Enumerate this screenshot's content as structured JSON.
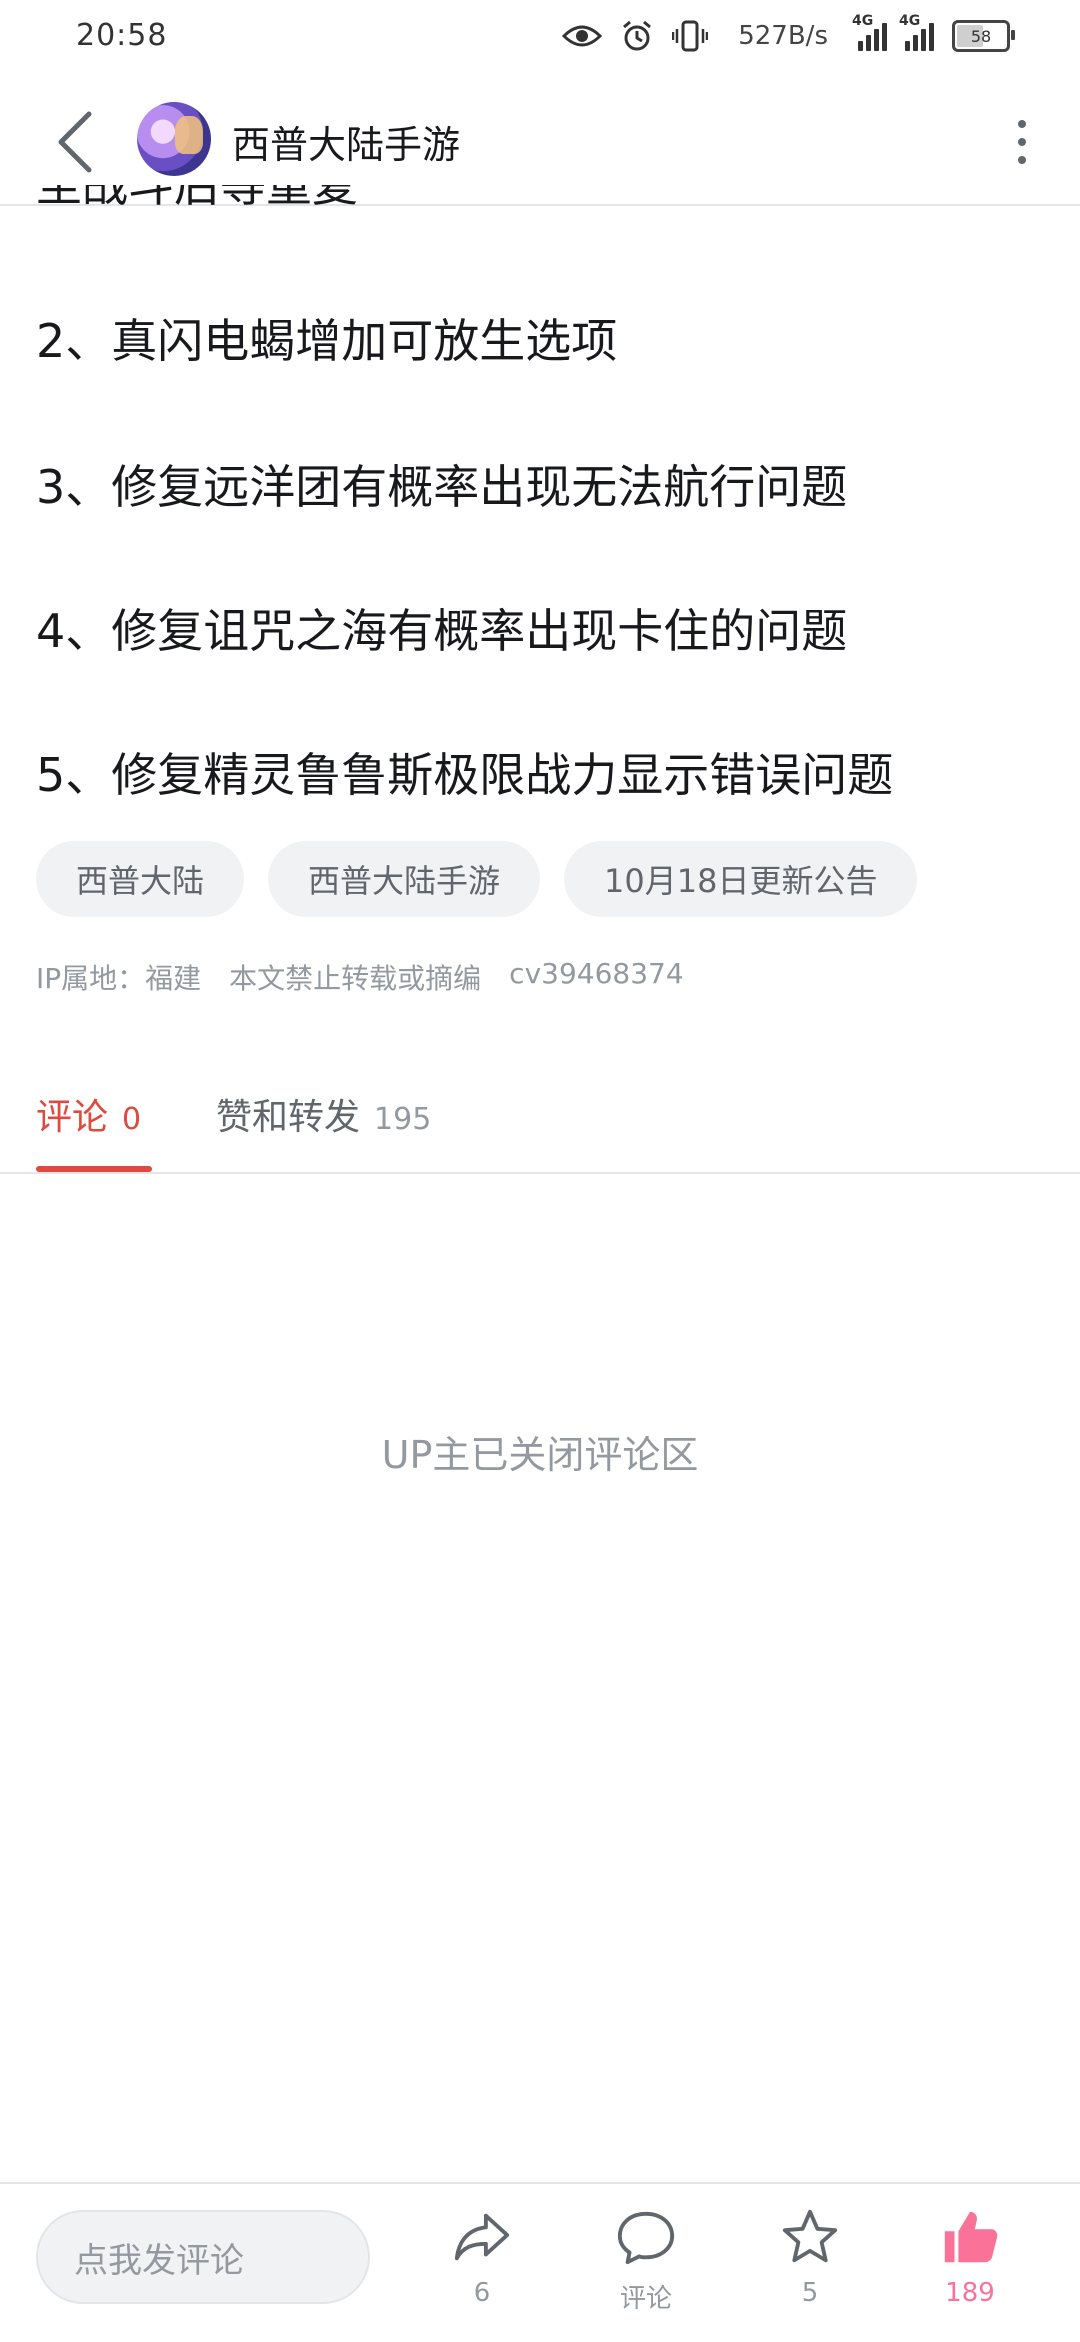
{
  "status_bar": {
    "time": "20:58",
    "speed": "527B/s",
    "network1": "4G",
    "network2": "4G",
    "battery": "58",
    "battery_level": 0.58
  },
  "header": {
    "title": "西普大陆手游"
  },
  "article": {
    "cut_line": "至战斗后等重复",
    "lines": [
      "2、真闪电蝎增加可放生选项",
      "3、修复远洋团有概率出现无法航行问题",
      "4、修复诅咒之海有概率出现卡住的问题",
      "5、修复精灵鲁鲁斯极限战力显示错误问题"
    ],
    "tags": [
      "西普大陆",
      "西普大陆手游",
      "10月18日更新公告"
    ],
    "meta": {
      "ip": "IP属地：福建",
      "rights": "本文禁止转载或摘编",
      "cv": "cv39468374"
    }
  },
  "tabs": [
    {
      "label": "评论",
      "count": "0"
    },
    {
      "label": "赞和转发",
      "count": "195"
    }
  ],
  "comments": {
    "closed_text": "UP主已关闭评论区"
  },
  "bottom_bar": {
    "input_placeholder": "点我发评论",
    "share_count": "6",
    "comment_label": "评论",
    "favorite_count": "5",
    "like_count": "189",
    "like_color": "#fb7299"
  }
}
